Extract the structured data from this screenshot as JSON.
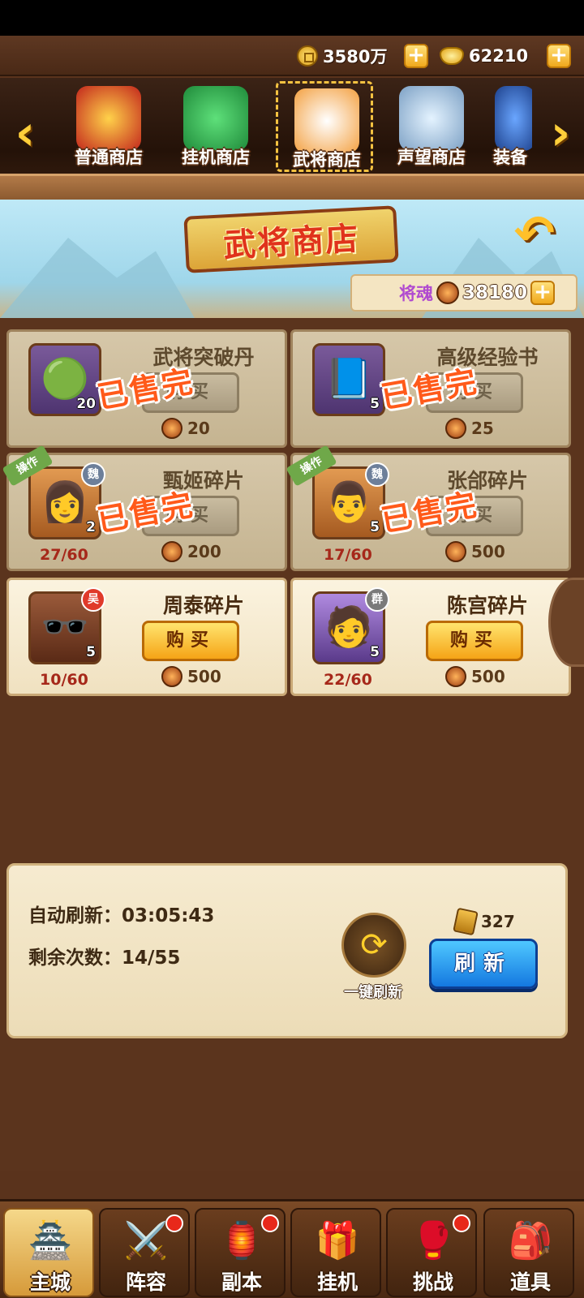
{
  "topbar": {
    "coins": "3580万",
    "ingots": "62210"
  },
  "tabs": [
    {
      "label": "普通商店",
      "icon": "treasure-chest-icon"
    },
    {
      "label": "挂机商店",
      "icon": "coin-jade-icon"
    },
    {
      "label": "武将商店",
      "icon": "chef-hero-icon"
    },
    {
      "label": "声望商店",
      "icon": "sword-shield-icon"
    },
    {
      "label": "装备",
      "icon": "armor-icon"
    }
  ],
  "banner": {
    "title": "武将商店",
    "soul_label": "将魂",
    "soul_value": "38180"
  },
  "items": [
    {
      "name": "武将突破丹",
      "qty": "20",
      "price": "20",
      "buy": "购买",
      "stamp": "已售完"
    },
    {
      "name": "高级经验书",
      "qty": "5",
      "price": "25",
      "buy": "购买",
      "stamp": "已售完"
    },
    {
      "name": "甄姬碎片",
      "qty": "2",
      "price": "200",
      "buy": "购买",
      "stamp": "已售完",
      "progress": "27/60",
      "tag": "操作",
      "faction": "魏"
    },
    {
      "name": "张郃碎片",
      "qty": "5",
      "price": "500",
      "buy": "购买",
      "stamp": "已售完",
      "progress": "17/60",
      "tag": "操作",
      "faction": "魏"
    },
    {
      "name": "周泰碎片",
      "qty": "5",
      "price": "500",
      "buy": "购买",
      "progress": "10/60",
      "faction": "吴"
    },
    {
      "name": "陈宫碎片",
      "qty": "5",
      "price": "500",
      "buy": "购买",
      "progress": "22/60",
      "faction": "群"
    }
  ],
  "refresh": {
    "auto_label": "自动刷新：03:05:43",
    "remain_label": "剩余次数：14/55",
    "onekey_label": "一键刷新",
    "cost": "327",
    "button": "刷新"
  },
  "nav": [
    {
      "label": "主城",
      "icon": "city-gate-icon"
    },
    {
      "label": "阵容",
      "icon": "formation-icon"
    },
    {
      "label": "副本",
      "icon": "dungeon-icon"
    },
    {
      "label": "挂机",
      "icon": "idle-gift-icon"
    },
    {
      "label": "挑战",
      "icon": "challenge-icon"
    },
    {
      "label": "道具",
      "icon": "items-bag-icon"
    }
  ]
}
